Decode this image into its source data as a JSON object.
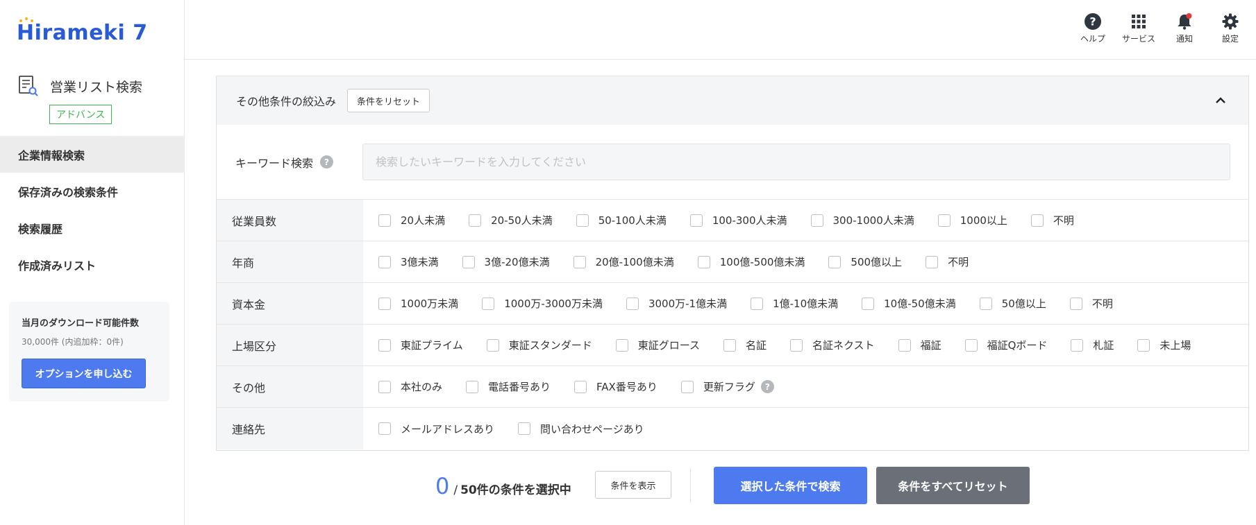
{
  "brand": {
    "logo_text": "Hirameki 7",
    "logo_color": "#2a5bd7",
    "accent": "#4d7bef"
  },
  "sidebar": {
    "page_title": "営業リスト検索",
    "page_icon": "list-search-icon",
    "badge": "アドバンス",
    "nav": [
      {
        "label": "企業情報検索",
        "active": true
      },
      {
        "label": "保存済みの検索条件",
        "active": false
      },
      {
        "label": "検索履歴",
        "active": false
      },
      {
        "label": "作成済みリスト",
        "active": false
      }
    ],
    "download": {
      "title": "当月のダウンロード可能件数",
      "sub": "30,000件 (内追加枠：0件)",
      "button": "オプションを申し込む"
    }
  },
  "topbar": {
    "items": [
      {
        "label": "ヘルプ",
        "icon": "help-icon"
      },
      {
        "label": "サービス",
        "icon": "grid-icon"
      },
      {
        "label": "通知",
        "icon": "bell-icon"
      },
      {
        "label": "設定",
        "icon": "gear-icon"
      }
    ]
  },
  "panel": {
    "title": "その他条件の絞込み",
    "reset_label": "条件をリセット",
    "keyword": {
      "label": "キーワード検索",
      "placeholder": "検索したいキーワードを入力してください",
      "value": ""
    },
    "rows": [
      {
        "label": "従業員数",
        "options": [
          "20人未満",
          "20-50人未満",
          "50-100人未満",
          "100-300人未満",
          "300-1000人未満",
          "1000以上",
          "不明"
        ]
      },
      {
        "label": "年商",
        "options": [
          "3億未満",
          "3億-20億未満",
          "20億-100億未満",
          "100億-500億未満",
          "500億以上",
          "不明"
        ]
      },
      {
        "label": "資本金",
        "options": [
          "1000万未満",
          "1000万-3000万未満",
          "3000万-1億未満",
          "1億-10億未満",
          "10億-50億未満",
          "50億以上",
          "不明"
        ]
      },
      {
        "label": "上場区分",
        "options": [
          "東証プライム",
          "東証スタンダード",
          "東証グロース",
          "名証",
          "名証ネクスト",
          "福証",
          "福証Qボード",
          "札証",
          "未上場"
        ]
      },
      {
        "label": "その他",
        "options": [
          "本社のみ",
          "電話番号あり",
          "FAX番号あり",
          "更新フラグ"
        ]
      },
      {
        "label": "連絡先",
        "options": [
          "メールアドレスあり",
          "問い合わせページあり"
        ]
      }
    ]
  },
  "footer": {
    "selected_count": "0",
    "slash": "/",
    "count_text": "50件の条件を選択中",
    "show_button": "条件を表示",
    "search_button": "選択した条件で検索",
    "reset_all_button": "条件をすべてリセット"
  }
}
